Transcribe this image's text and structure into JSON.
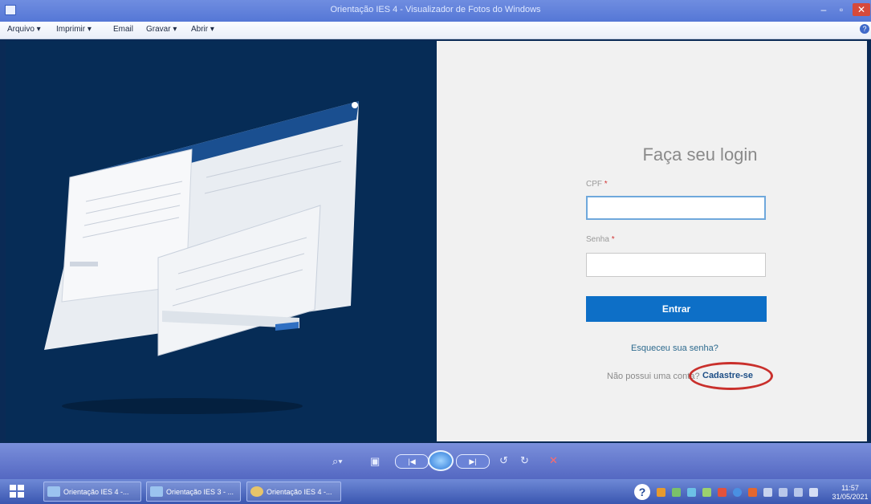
{
  "window": {
    "title": "Orientação IES 4 - Visualizador de Fotos do Windows",
    "minimize_glyph": "–",
    "maximize_glyph": "▫",
    "close_glyph": "✕"
  },
  "menu": {
    "items": [
      "Arquivo ▾",
      "Imprimir ▾",
      "Email",
      "Gravar ▾",
      "Abrir ▾"
    ],
    "help_glyph": "?"
  },
  "login": {
    "title": "Faça seu login",
    "cpf_label": "CPF",
    "senha_label": "Senha",
    "required_mark": "*",
    "cpf_value": "",
    "senha_value": "",
    "submit_label": "Entrar",
    "forgot_label": "Esqueceu sua senha?",
    "no_account_label": "Não possui uma conta?",
    "register_label": "Cadastre-se",
    "highlight_color": "#c9302c"
  },
  "controls": {
    "zoom": "⌕▾",
    "fit": "▣",
    "prev": "|◀",
    "next": "▶|",
    "rotate_ccw": "↺",
    "rotate_cw": "↻",
    "delete": "✕"
  },
  "taskbar": {
    "items": [
      "Orientação IES 4 -...",
      "Orientação IES 3 - ...",
      "Orientação IES 4 -..."
    ],
    "help_glyph": "?",
    "time": "11:57",
    "date": "31/05/2021"
  },
  "colors": {
    "left_panel": "#062c56",
    "primary_button": "#0d6fc7",
    "link": "#2d6a8e"
  }
}
